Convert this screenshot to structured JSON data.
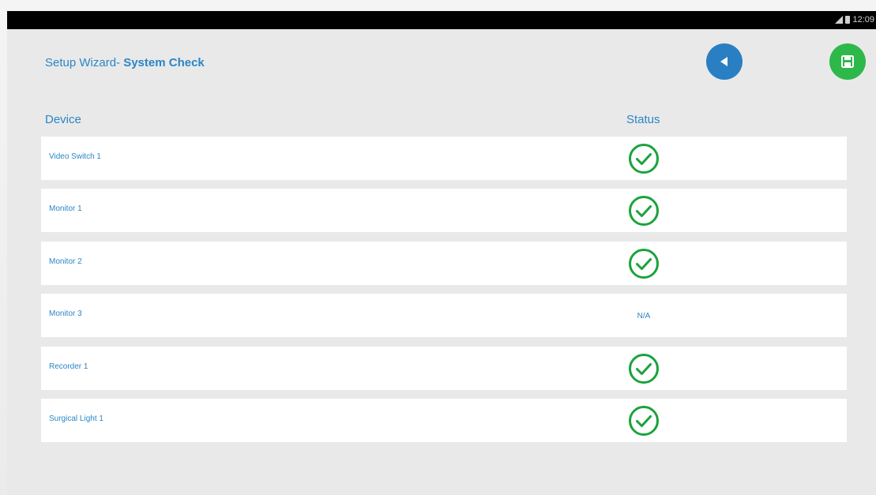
{
  "status_bar": {
    "time": "12:09"
  },
  "header": {
    "title_prefix": "Setup Wizard-",
    "title_bold": " System Check",
    "back_button_icon": "back-arrow-icon",
    "save_button_icon": "save-icon"
  },
  "table": {
    "columns": [
      "Device",
      "Status"
    ],
    "rows": [
      {
        "device": "Video Switch 1",
        "status": "ok"
      },
      {
        "device": "Monitor 1",
        "status": "ok"
      },
      {
        "device": "Monitor 2",
        "status": "ok"
      },
      {
        "device": "Monitor 3",
        "status": "N/A"
      },
      {
        "device": "Recorder 1",
        "status": "ok"
      },
      {
        "device": "Surgical Light 1",
        "status": "ok"
      }
    ]
  },
  "colors": {
    "accent_blue": "#2a86c6",
    "back_button": "#2a7fc2",
    "save_button": "#2eb84a",
    "check_green": "#1aa33c"
  }
}
